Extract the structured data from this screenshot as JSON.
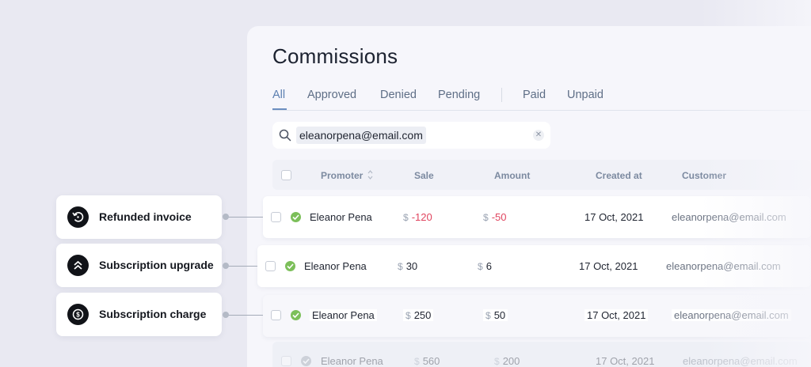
{
  "page": {
    "title": "Commissions"
  },
  "tabs": [
    {
      "label": "All",
      "active": true
    },
    {
      "label": "Approved",
      "active": false
    },
    {
      "label": "Denied",
      "active": false
    },
    {
      "label": "Pending",
      "active": false
    },
    {
      "label": "Paid",
      "active": false
    },
    {
      "label": "Unpaid",
      "active": false
    }
  ],
  "search": {
    "value": "eleanorpena@email.com",
    "clear_icon": "close-icon",
    "icon": "search-icon"
  },
  "table": {
    "columns": [
      "Promoter",
      "Sale",
      "Amount",
      "Created at",
      "Customer"
    ],
    "currency": "$",
    "rows": [
      {
        "promoter": "Eleanor Pena",
        "sale": "-120",
        "amount": "-50",
        "created": "17 Oct, 2021",
        "customer": "eleanorpena@email.com",
        "status_icon": "check-circle-icon"
      },
      {
        "promoter": "Eleanor Pena",
        "sale": "30",
        "amount": "6",
        "created": "17 Oct, 2021",
        "customer": "eleanorpena@email.com",
        "status_icon": "check-circle-icon"
      },
      {
        "promoter": "Eleanor Pena",
        "sale": "250",
        "amount": "50",
        "created": "17 Oct, 2021",
        "customer": "eleanorpena@email.com",
        "status_icon": "check-circle-icon"
      },
      {
        "promoter": "Eleanor Pena",
        "sale": "560",
        "amount": "200",
        "created": "17 Oct, 2021",
        "customer": "eleanorpena@email.com",
        "status_icon": "check-circle-icon"
      }
    ]
  },
  "labels": [
    {
      "text": "Refunded invoice",
      "icon": "refund-icon"
    },
    {
      "text": "Subscription upgrade",
      "icon": "chevrons-up-icon"
    },
    {
      "text": "Subscription charge",
      "icon": "dollar-coin-icon"
    }
  ],
  "colors": {
    "negative": "#e0455f",
    "approved": "#7cbf5a",
    "accent": "#5b7fb0"
  }
}
